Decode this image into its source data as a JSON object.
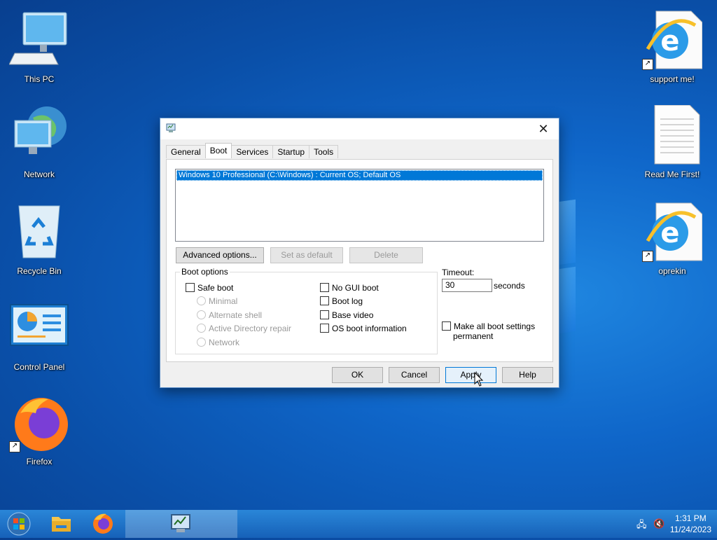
{
  "desktop": {
    "icons_left": [
      {
        "label": "This PC",
        "icon": "computer-icon"
      },
      {
        "label": "Network",
        "icon": "network-globe-icon"
      },
      {
        "label": "Recycle Bin",
        "icon": "recycle-bin-icon"
      },
      {
        "label": "Control Panel",
        "icon": "control-panel-icon"
      },
      {
        "label": "Firefox",
        "icon": "firefox-icon"
      }
    ],
    "icons_right": [
      {
        "label": "support me!",
        "icon": "internet-explorer-icon"
      },
      {
        "label": "Read Me First!",
        "icon": "text-document-icon"
      },
      {
        "label": "oprekin",
        "icon": "internet-explorer-icon"
      }
    ]
  },
  "dialog": {
    "close_glyph": "✕",
    "tabs": [
      "General",
      "Boot",
      "Services",
      "Startup",
      "Tools"
    ],
    "active_tab": "Boot",
    "os_entries": [
      "Windows 10 Professional (C:\\Windows) : Current OS; Default OS"
    ],
    "buttons": {
      "advanced": "Advanced options...",
      "set_default": "Set as default",
      "delete": "Delete"
    },
    "boot_options": {
      "legend": "Boot options",
      "safe_boot": "Safe boot",
      "minimal": "Minimal",
      "alternate_shell": "Alternate shell",
      "ad_repair": "Active Directory repair",
      "network": "Network",
      "no_gui_boot": "No GUI boot",
      "boot_log": "Boot log",
      "base_video": "Base video",
      "os_boot_info": "OS boot information"
    },
    "timeout": {
      "label": "Timeout:",
      "value": "30",
      "unit": "seconds"
    },
    "make_permanent_line1": "Make all boot settings",
    "make_permanent_line2": "permanent",
    "footer": {
      "ok": "OK",
      "cancel": "Cancel",
      "apply": "Apply",
      "help": "Help"
    }
  },
  "taskbar": {
    "time": "1:31 PM",
    "date": "11/24/2023"
  }
}
